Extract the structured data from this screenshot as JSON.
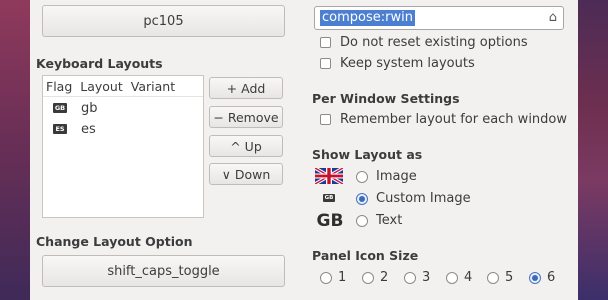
{
  "window": {
    "model_button": "pc105",
    "keyboard_layouts_heading": "Keyboard Layouts",
    "columns": [
      "Flag",
      "Layout",
      "Variant"
    ],
    "layouts": [
      {
        "flag": "GB",
        "layout": "gb",
        "variant": ""
      },
      {
        "flag": "ES",
        "layout": "es",
        "variant": ""
      }
    ],
    "buttons": {
      "add": "+ Add",
      "remove": "− Remove",
      "up": "^ Up",
      "down": "∨ Down"
    },
    "change_layout_option_heading": "Change Layout Option",
    "change_layout_option_value": "shift_caps_toggle"
  },
  "options": {
    "compose_value": "compose:rwin",
    "do_not_reset": "Do not reset existing options",
    "keep_system": "Keep system layouts",
    "per_window_heading": "Per Window Settings",
    "remember_layout": "Remember layout for each window",
    "show_layout_heading": "Show Layout as",
    "show_layout_options": [
      "Image",
      "Custom Image",
      "Text"
    ],
    "show_layout_selected": "Custom Image",
    "text_preview": "GB",
    "custom_image_preview": "GB",
    "panel_icon_heading": "Panel Icon Size",
    "panel_icon_sizes": [
      "1",
      "2",
      "3",
      "4",
      "5",
      "6"
    ],
    "panel_icon_selected": "6"
  },
  "colors": {
    "accent": "#4d7fd0",
    "panel_bg": "#f2f1f0"
  }
}
